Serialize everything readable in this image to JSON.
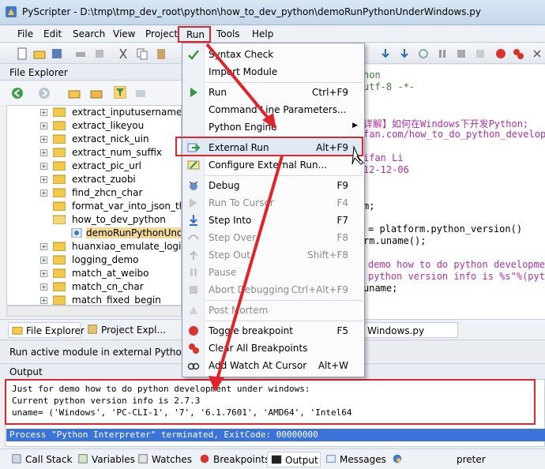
{
  "window": {
    "title": "PyScripter - D:\\tmp\\tmp_dev_root\\python\\how_to_dev_python\\demoRunPythonUnderWindows.py"
  },
  "menubar": {
    "items": [
      "File",
      "Edit",
      "Search",
      "View",
      "Project",
      "Run",
      "Tools",
      "Help"
    ]
  },
  "file_explorer": {
    "title": "File Explorer",
    "tree": [
      {
        "label": "extract_inputusername",
        "expandable": true
      },
      {
        "label": "extract_likeyou",
        "expandable": true
      },
      {
        "label": "extract_nick_uin",
        "expandable": true
      },
      {
        "label": "extract_num_suffix",
        "expandable": true
      },
      {
        "label": "extract_pic_url",
        "expandable": true
      },
      {
        "label": "extract_zuobi",
        "expandable": true
      },
      {
        "label": "find_zhcn_char",
        "expandable": true
      },
      {
        "label": "format_var_into_json_then",
        "expandable": false
      },
      {
        "label": "how_to_dev_python",
        "expandable": false
      },
      {
        "label": "demoRunPythonUnder",
        "expandable": false,
        "selected": true
      },
      {
        "label": "huanxiao_emulate_login",
        "expandable": true
      },
      {
        "label": "logging_demo",
        "expandable": true
      },
      {
        "label": "match_at_weibo",
        "expandable": true
      },
      {
        "label": "match_cn_char",
        "expandable": true
      },
      {
        "label": "match_fixed_begin",
        "expandable": true
      }
    ],
    "tabs": [
      "File Explorer",
      "Project Expl..."
    ]
  },
  "editor": {
    "tab": "Windows.py",
    "lines": [
      "hon",
      "utf-8 -*-",
      "",
      "详解】如何在Windows下开发Python;",
      "fan.com/how_to_do_python_develop",
      "",
      "ifan Li",
      "12-12-06",
      "",
      "",
      "m;",
      "",
      "",
      "= platform.python_version()",
      "rm.uname();",
      "",
      "demo how to do python developme",
      "python version info is %s\"%(pyt",
      "uname;"
    ]
  },
  "run_menu": {
    "items": [
      {
        "label": "Syntax Check",
        "shortcut": "",
        "disabled": false,
        "icon": "check-icon"
      },
      {
        "label": "Import Module",
        "shortcut": "",
        "disabled": false,
        "icon": ""
      },
      {
        "label": "Run",
        "shortcut": "Ctrl+F9",
        "disabled": false,
        "icon": "play-icon"
      },
      {
        "label": "Command Line Parameters...",
        "shortcut": "",
        "disabled": false,
        "icon": ""
      },
      {
        "label": "Python Engine",
        "shortcut": "",
        "disabled": false,
        "icon": "",
        "submenu": true
      },
      {
        "label": "External Run",
        "shortcut": "Alt+F9",
        "disabled": false,
        "icon": "external-run-icon"
      },
      {
        "label": "Configure External Run...",
        "shortcut": "",
        "disabled": false,
        "icon": "configure-icon"
      },
      {
        "label": "Debug",
        "shortcut": "F9",
        "disabled": false,
        "icon": "debug-icon"
      },
      {
        "label": "Run To Cursor",
        "shortcut": "F4",
        "disabled": true,
        "icon": "run-to-cursor-icon"
      },
      {
        "label": "Step Into",
        "shortcut": "F7",
        "disabled": false,
        "icon": "step-into-icon"
      },
      {
        "label": "Step Over",
        "shortcut": "F8",
        "disabled": true,
        "icon": "step-over-icon"
      },
      {
        "label": "Step Out",
        "shortcut": "Shift+F8",
        "disabled": true,
        "icon": "step-out-icon"
      },
      {
        "label": "Pause",
        "shortcut": "",
        "disabled": true,
        "icon": "pause-icon"
      },
      {
        "label": "Abort Debugging",
        "shortcut": "Ctrl+Alt+F9",
        "disabled": true,
        "icon": "abort-icon"
      },
      {
        "label": "Post Mortem",
        "shortcut": "",
        "disabled": true,
        "icon": "post-mortem-icon"
      },
      {
        "label": "Toggle breakpoint",
        "shortcut": "F5",
        "disabled": false,
        "icon": "breakpoint-icon"
      },
      {
        "label": "Clear All Breakpoints",
        "shortcut": "",
        "disabled": false,
        "icon": "clear-breakpoints-icon"
      },
      {
        "label": "Add Watch At Cursor",
        "shortcut": "Alt+W",
        "disabled": false,
        "icon": "watch-icon"
      }
    ]
  },
  "status": {
    "text": "Run active module in external Python inte"
  },
  "output": {
    "title": "Output",
    "lines": [
      "Just for demo how to do python development under windows:",
      "Current python version info is 2.7.3",
      "uname= ('Windows', 'PC-CLI-1', '7', '6.1.7601', 'AMD64', 'Intel64"
    ],
    "process_line": "Process \"Python Interpreter\" terminated, ExitCode: 00000000"
  },
  "bottom_tabs": [
    "Call Stack",
    "Variables",
    "Watches",
    "Breakpoints",
    "Output",
    "Messages",
    "preter"
  ],
  "colors": {
    "highlight_box": "#e0242b",
    "selection": "#3a74d8"
  }
}
